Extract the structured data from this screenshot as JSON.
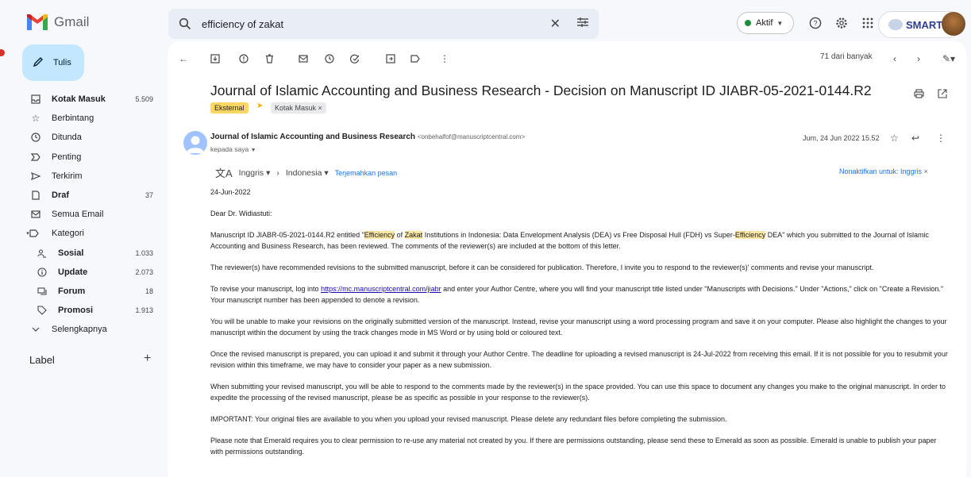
{
  "app": {
    "name": "Gmail",
    "colors": {
      "accent": "#0b57d0",
      "compose_bg": "#c2e7ff",
      "search_bg": "#e9eef6",
      "label_external": "#fdd663",
      "highlight": "#fbe7a1"
    }
  },
  "search": {
    "query": "efficiency of zakat"
  },
  "header": {
    "status_label": "Aktif",
    "org_name": "SMART"
  },
  "compose": {
    "label": "Tulis"
  },
  "sidebar": {
    "items": [
      {
        "label": "Kotak Masuk",
        "count": "5.509",
        "icon": "inbox-icon",
        "bold": true
      },
      {
        "label": "Berbintang",
        "count": "",
        "icon": "star-icon",
        "bold": false
      },
      {
        "label": "Ditunda",
        "count": "",
        "icon": "clock-icon",
        "bold": false
      },
      {
        "label": "Penting",
        "count": "",
        "icon": "important-icon",
        "bold": false
      },
      {
        "label": "Terkirim",
        "count": "",
        "icon": "send-icon",
        "bold": false
      },
      {
        "label": "Draf",
        "count": "37",
        "icon": "draft-icon",
        "bold": true
      },
      {
        "label": "Semua Email",
        "count": "",
        "icon": "all-mail-icon",
        "bold": false
      },
      {
        "label": "Kategori",
        "count": "",
        "icon": "label-icon",
        "bold": false
      },
      {
        "label": "Sosial",
        "count": "1.033",
        "icon": "people-icon",
        "bold": true
      },
      {
        "label": "Update",
        "count": "2.073",
        "icon": "info-icon",
        "bold": true
      },
      {
        "label": "Forum",
        "count": "18",
        "icon": "forum-icon",
        "bold": true
      },
      {
        "label": "Promosi",
        "count": "1.913",
        "icon": "tag-icon",
        "bold": true
      },
      {
        "label": "Selengkapnya",
        "count": "",
        "icon": "chevron-down-icon",
        "bold": false
      }
    ],
    "label_header": "Label"
  },
  "toolbar": {
    "pager": "71 dari banyak"
  },
  "email": {
    "subject": "Journal of Islamic Accounting and Business Research - Decision on Manuscript ID JIABR-05-2021-0144.R2",
    "labels": [
      "Eksternal",
      "Kotak Masuk"
    ],
    "sender_name": "Journal of Islamic Accounting and Business Research",
    "sender_email": "<onbehalfof@manuscriptcentral.com>",
    "to": "kepada saya",
    "date": "Jum, 24 Jun 2022 15.52",
    "translate": {
      "from": "Inggris",
      "to": "Indonesia",
      "action": "Terjemahkan pesan",
      "disable": "Nonaktifkan untuk: Inggris"
    },
    "body": {
      "date": "24-Jun-2022",
      "greeting": "Dear Dr. Widiastuti:",
      "p1_a": "Manuscript ID JIABR-05-2021-0144.R2 entitled \"",
      "p1_hl1": "Efficiency",
      "p1_b": " of ",
      "p1_hl2": "Zakat",
      "p1_c": " Institutions in Indonesia: Data Envelopment Analysis (DEA) vs Free Disposal Hull (FDH) vs Super-",
      "p1_hl3": "Efficiency",
      "p1_d": " DEA\" which you submitted to the Journal of Islamic Accounting and Business Research, has been reviewed.  The comments of the reviewer(s) are included at the bottom of this letter.",
      "p2": "The reviewer(s) have recommended revisions to the submitted manuscript, before it can be considered for publication. Therefore, I invite you to respond to the reviewer(s)' comments and revise your manuscript.",
      "p3_a": "To revise your manuscript, log into ",
      "p3_link": "https://mc.manuscriptcentral.com/jiabr",
      "p3_b": " and enter your Author Centre, where you will find your manuscript title listed under \"Manuscripts with Decisions.\"  Under \"Actions,\" click on \"Create a Revision.\"  Your manuscript number has been appended to denote a revision.",
      "p4": "You will be unable to make your revisions on the originally submitted version of the manuscript.  Instead, revise your manuscript using a word processing program and save it on your computer.  Please also highlight the changes to your manuscript within the document by using the track changes mode in MS Word or by using bold or coloured text.",
      "p5": "Once the revised manuscript is prepared, you can upload it and submit it through your Author Centre. The deadline for uploading a revised manuscript is 24-Jul-2022 from receiving this email. If it is not possible for you to resubmit your revision within this timeframe, we may have to consider your paper as a new submission.",
      "p6": "When submitting your revised manuscript, you will be able to respond to the comments made by the reviewer(s) in the space provided.  You can use this space to document any changes you make to the original manuscript.  In order to expedite the processing of the revised manuscript, please be as specific as possible in your response to the reviewer(s).",
      "p7": "IMPORTANT:  Your original files are available to you when you upload your revised manuscript.  Please delete any redundant files before completing the submission.",
      "p8": "Please note that Emerald requires you to clear permission to re-use any material not created by you.  If there are permissions outstanding, please send these to Emerald as soon as possible.  Emerald is unable to publish your paper with permissions outstanding."
    }
  }
}
